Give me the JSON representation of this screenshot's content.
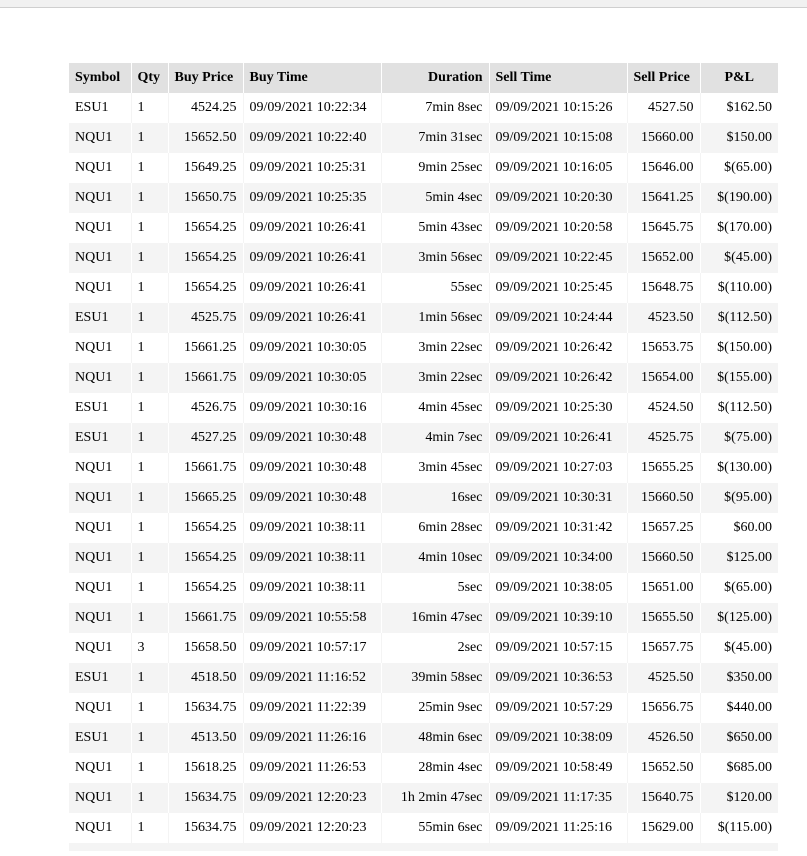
{
  "table": {
    "headers": [
      "Symbol",
      "Qty",
      "Buy Price",
      "Buy Time",
      "Duration",
      "Sell Time",
      "Sell Price",
      "P&L"
    ],
    "rows": [
      [
        "ESU1",
        "1",
        "4524.25",
        "09/09/2021 10:22:34",
        "7min 8sec",
        "09/09/2021 10:15:26",
        "4527.50",
        "$162.50"
      ],
      [
        "NQU1",
        "1",
        "15652.50",
        "09/09/2021 10:22:40",
        "7min 31sec",
        "09/09/2021 10:15:08",
        "15660.00",
        "$150.00"
      ],
      [
        "NQU1",
        "1",
        "15649.25",
        "09/09/2021 10:25:31",
        "9min 25sec",
        "09/09/2021 10:16:05",
        "15646.00",
        "$(65.00)"
      ],
      [
        "NQU1",
        "1",
        "15650.75",
        "09/09/2021 10:25:35",
        "5min 4sec",
        "09/09/2021 10:20:30",
        "15641.25",
        "$(190.00)"
      ],
      [
        "NQU1",
        "1",
        "15654.25",
        "09/09/2021 10:26:41",
        "5min 43sec",
        "09/09/2021 10:20:58",
        "15645.75",
        "$(170.00)"
      ],
      [
        "NQU1",
        "1",
        "15654.25",
        "09/09/2021 10:26:41",
        "3min 56sec",
        "09/09/2021 10:22:45",
        "15652.00",
        "$(45.00)"
      ],
      [
        "NQU1",
        "1",
        "15654.25",
        "09/09/2021 10:26:41",
        "55sec",
        "09/09/2021 10:25:45",
        "15648.75",
        "$(110.00)"
      ],
      [
        "ESU1",
        "1",
        "4525.75",
        "09/09/2021 10:26:41",
        "1min 56sec",
        "09/09/2021 10:24:44",
        "4523.50",
        "$(112.50)"
      ],
      [
        "NQU1",
        "1",
        "15661.25",
        "09/09/2021 10:30:05",
        "3min 22sec",
        "09/09/2021 10:26:42",
        "15653.75",
        "$(150.00)"
      ],
      [
        "NQU1",
        "1",
        "15661.75",
        "09/09/2021 10:30:05",
        "3min 22sec",
        "09/09/2021 10:26:42",
        "15654.00",
        "$(155.00)"
      ],
      [
        "ESU1",
        "1",
        "4526.75",
        "09/09/2021 10:30:16",
        "4min 45sec",
        "09/09/2021 10:25:30",
        "4524.50",
        "$(112.50)"
      ],
      [
        "ESU1",
        "1",
        "4527.25",
        "09/09/2021 10:30:48",
        "4min 7sec",
        "09/09/2021 10:26:41",
        "4525.75",
        "$(75.00)"
      ],
      [
        "NQU1",
        "1",
        "15661.75",
        "09/09/2021 10:30:48",
        "3min 45sec",
        "09/09/2021 10:27:03",
        "15655.25",
        "$(130.00)"
      ],
      [
        "NQU1",
        "1",
        "15665.25",
        "09/09/2021 10:30:48",
        "16sec",
        "09/09/2021 10:30:31",
        "15660.50",
        "$(95.00)"
      ],
      [
        "NQU1",
        "1",
        "15654.25",
        "09/09/2021 10:38:11",
        "6min 28sec",
        "09/09/2021 10:31:42",
        "15657.25",
        "$60.00"
      ],
      [
        "NQU1",
        "1",
        "15654.25",
        "09/09/2021 10:38:11",
        "4min 10sec",
        "09/09/2021 10:34:00",
        "15660.50",
        "$125.00"
      ],
      [
        "NQU1",
        "1",
        "15654.25",
        "09/09/2021 10:38:11",
        "5sec",
        "09/09/2021 10:38:05",
        "15651.00",
        "$(65.00)"
      ],
      [
        "NQU1",
        "1",
        "15661.75",
        "09/09/2021 10:55:58",
        "16min 47sec",
        "09/09/2021 10:39:10",
        "15655.50",
        "$(125.00)"
      ],
      [
        "NQU1",
        "3",
        "15658.50",
        "09/09/2021 10:57:17",
        "2sec",
        "09/09/2021 10:57:15",
        "15657.75",
        "$(45.00)"
      ],
      [
        "ESU1",
        "1",
        "4518.50",
        "09/09/2021 11:16:52",
        "39min 58sec",
        "09/09/2021 10:36:53",
        "4525.50",
        "$350.00"
      ],
      [
        "NQU1",
        "1",
        "15634.75",
        "09/09/2021 11:22:39",
        "25min 9sec",
        "09/09/2021 10:57:29",
        "15656.75",
        "$440.00"
      ],
      [
        "ESU1",
        "1",
        "4513.50",
        "09/09/2021 11:26:16",
        "48min 6sec",
        "09/09/2021 10:38:09",
        "4526.50",
        "$650.00"
      ],
      [
        "NQU1",
        "1",
        "15618.25",
        "09/09/2021 11:26:53",
        "28min 4sec",
        "09/09/2021 10:58:49",
        "15652.50",
        "$685.00"
      ],
      [
        "NQU1",
        "1",
        "15634.75",
        "09/09/2021 12:20:23",
        "1h 2min 47sec",
        "09/09/2021 11:17:35",
        "15640.75",
        "$120.00"
      ],
      [
        "NQU1",
        "1",
        "15634.75",
        "09/09/2021 12:20:23",
        "55min 6sec",
        "09/09/2021 11:25:16",
        "15629.00",
        "$(115.00)"
      ]
    ]
  }
}
